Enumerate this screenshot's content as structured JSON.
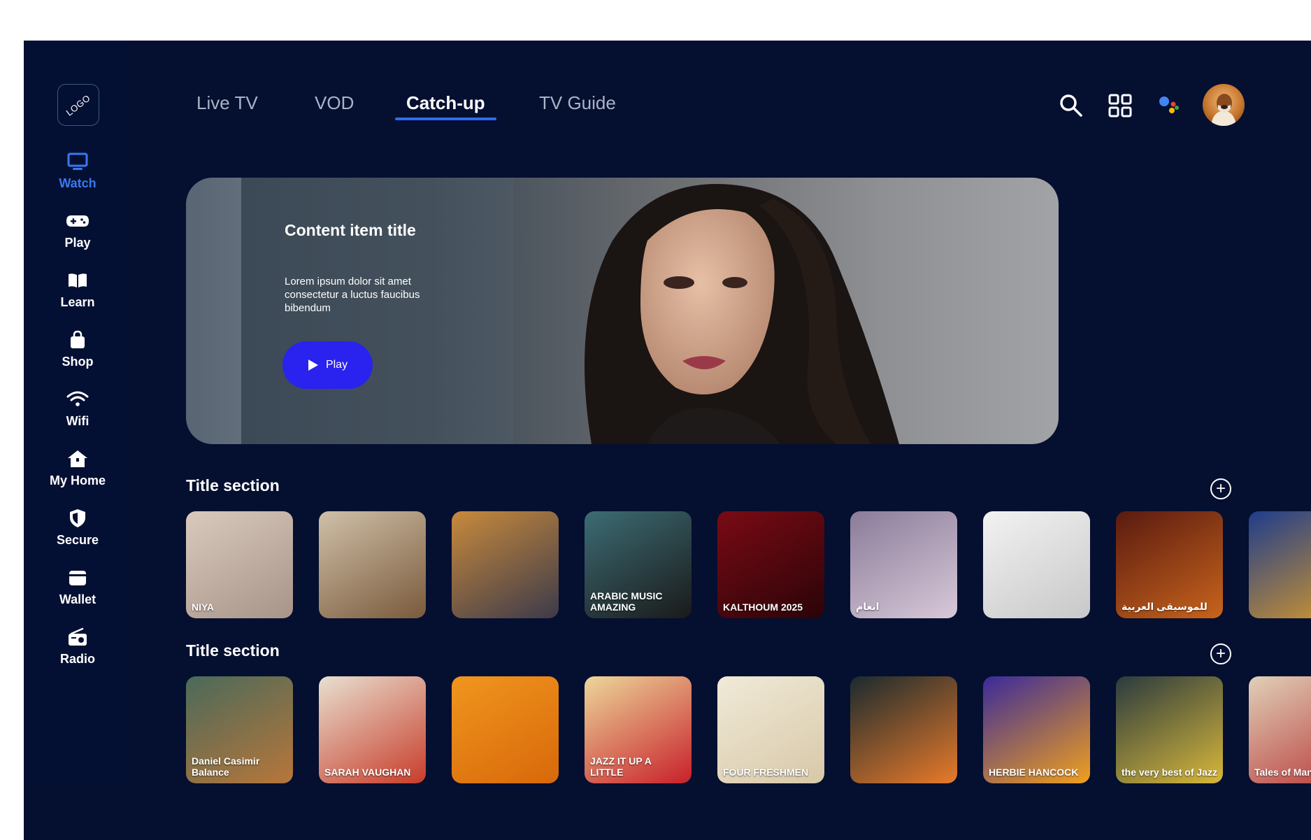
{
  "brand": {
    "logo_text": "LOGO"
  },
  "sidebar": {
    "items": [
      {
        "label": "Watch",
        "icon": "tv-icon",
        "active": true
      },
      {
        "label": "Play",
        "icon": "gamepad-icon"
      },
      {
        "label": "Learn",
        "icon": "book-icon"
      },
      {
        "label": "Shop",
        "icon": "shopping-bag-icon"
      },
      {
        "label": "Wifi",
        "icon": "wifi-icon"
      },
      {
        "label": "My Home",
        "icon": "home-icon"
      },
      {
        "label": "Secure",
        "icon": "shield-icon"
      },
      {
        "label": "Wallet",
        "icon": "wallet-icon"
      },
      {
        "label": "Radio",
        "icon": "radio-icon"
      }
    ]
  },
  "header": {
    "tabs": [
      {
        "label": "Live TV"
      },
      {
        "label": "VOD"
      },
      {
        "label": "Catch-up",
        "active": true
      },
      {
        "label": "TV Guide"
      }
    ],
    "icons": [
      "search-icon",
      "grid-icon",
      "assistant-icon",
      "avatar"
    ]
  },
  "hero": {
    "title": "Content item title",
    "description": "Lorem ipsum dolor sit amet consectetur a luctus faucibus bibendum",
    "play_label": "Play"
  },
  "sections": [
    {
      "title": "Title section",
      "tiles": [
        {
          "caption": "NIYA",
          "colors": [
            "#d9c9bd",
            "#a89488"
          ]
        },
        {
          "caption": "",
          "colors": [
            "#cfc0a8",
            "#7a5a3c"
          ]
        },
        {
          "caption": "",
          "colors": [
            "#c88a3c",
            "#3c3a4a"
          ]
        },
        {
          "caption": "ARABIC MUSIC AMAZING",
          "colors": [
            "#3c6c74",
            "#1a1a1a"
          ]
        },
        {
          "caption": "KALTHOUM 2025",
          "colors": [
            "#7a0a14",
            "#2a0408"
          ]
        },
        {
          "caption": "انغام",
          "colors": [
            "#8a7c9a",
            "#d8c8d8"
          ]
        },
        {
          "caption": "",
          "colors": [
            "#f2f2f2",
            "#c8c8c8"
          ]
        },
        {
          "caption": "للموسيقى العربية",
          "colors": [
            "#5a1a10",
            "#c8641c"
          ]
        },
        {
          "caption": "",
          "colors": [
            "#1e3c8c",
            "#d89a2a"
          ]
        }
      ]
    },
    {
      "title": "Title section",
      "tiles": [
        {
          "caption": "Daniel Casimir Balance",
          "colors": [
            "#4a6a5a",
            "#b8763a"
          ]
        },
        {
          "caption": "SARAH VAUGHAN",
          "colors": [
            "#e8e0d0",
            "#c83c2a"
          ]
        },
        {
          "caption": "",
          "colors": [
            "#f0961e",
            "#d8680a"
          ]
        },
        {
          "caption": "JAZZ IT UP A LITTLE",
          "colors": [
            "#ecd79a",
            "#c8202a"
          ]
        },
        {
          "caption": "FOUR FRESHMEN",
          "colors": [
            "#f0ead8",
            "#d8c8a8"
          ]
        },
        {
          "caption": "",
          "colors": [
            "#1a2a2e",
            "#e87a2a"
          ]
        },
        {
          "caption": "HERBIE HANCOCK",
          "colors": [
            "#3a2a9a",
            "#f0a01e"
          ]
        },
        {
          "caption": "the very best of Jazz",
          "colors": [
            "#2a3a3e",
            "#d8b83a"
          ]
        },
        {
          "caption": "Tales of Manhattan",
          "colors": [
            "#e0d0b8",
            "#b83a3a"
          ]
        }
      ]
    }
  ]
}
